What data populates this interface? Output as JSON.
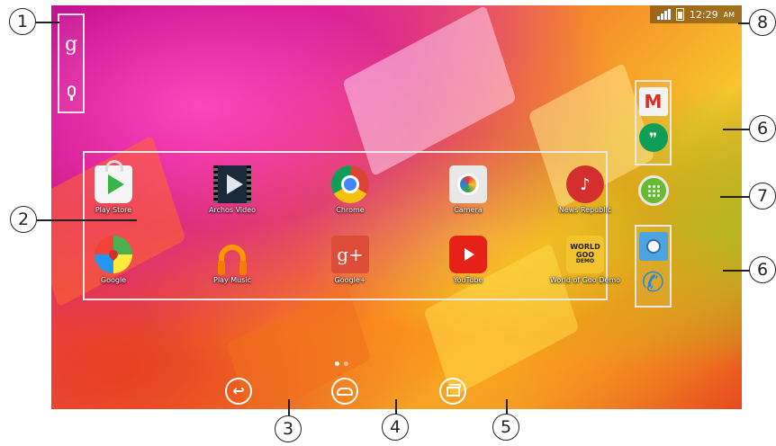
{
  "status_bar": {
    "time": "12:29",
    "ampm": "AM"
  },
  "search_widget": {
    "google_glyph": "g",
    "icons": [
      "google-search-icon",
      "mic-icon"
    ]
  },
  "apps": [
    {
      "label": "Play Store",
      "icon": "play-store-icon"
    },
    {
      "label": "Archos Video",
      "icon": "archos-video-icon"
    },
    {
      "label": "Chrome",
      "icon": "chrome-icon"
    },
    {
      "label": "Camera",
      "icon": "camera-icon"
    },
    {
      "label": "News Republic",
      "icon": "news-republic-icon"
    },
    {
      "label": "Google",
      "icon": "google-maps-folder-icon"
    },
    {
      "label": "Play Music",
      "icon": "play-music-icon"
    },
    {
      "label": "Google+",
      "icon": "google-plus-icon"
    },
    {
      "label": "YouTube",
      "icon": "youtube-icon"
    },
    {
      "label": "World of Goo Demo",
      "icon": "world-of-goo-icon"
    }
  ],
  "icon_glyphs": {
    "news": "♪",
    "gplus": "g+",
    "goo_top": "WORLD",
    "goo_mid": "GOO",
    "goo_bot": "DEMO",
    "gmail": "M",
    "hangouts": "❞",
    "phone": "✆",
    "back": "↩"
  },
  "dock": {
    "top": [
      "gmail-icon",
      "hangouts-icon"
    ],
    "bottom": [
      "contacts-icon",
      "phone-icon"
    ],
    "all_apps": "all-apps-icon"
  },
  "pager": {
    "pages": 2,
    "current": 0
  },
  "navigation": [
    "back-button",
    "home-button",
    "recent-apps-button"
  ],
  "callouts": [
    "1",
    "2",
    "3",
    "4",
    "5",
    "6",
    "7",
    "6",
    "8"
  ],
  "colors": {
    "all_apps": "#66bb33",
    "youtube": "#e62117",
    "gplus": "#dd4b39"
  }
}
